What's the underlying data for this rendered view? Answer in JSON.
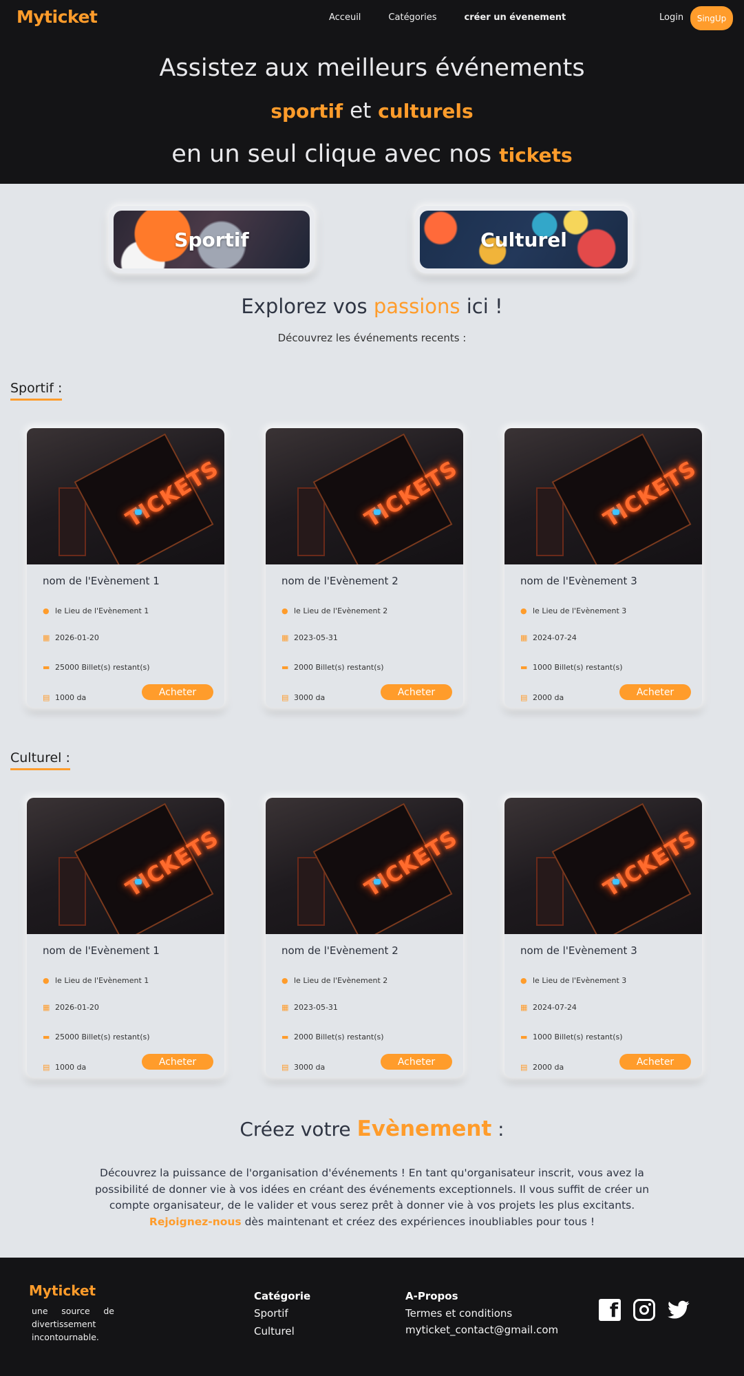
{
  "colors": {
    "accent": "#ff9c2b",
    "dark": "#141416",
    "background": "#e2e5e9"
  },
  "header": {
    "logo": "Myticket",
    "nav": [
      "Acceuil",
      "Catégories",
      "créer un évenement"
    ],
    "login": "Login",
    "signup": "SingUp"
  },
  "hero": {
    "line1": "Assistez aux meilleurs événements",
    "line2_a": "sportif",
    "line2_b": " et ",
    "line2_c": "culturels",
    "line3_a": "en un seul clique avec nos ",
    "line3_b": "tickets"
  },
  "categories": [
    {
      "label": "Sportif"
    },
    {
      "label": "Culturel"
    }
  ],
  "explore": {
    "a": "Explorez vos ",
    "b": "passions",
    "c": " ici !",
    "subtitle": "Découvrez les événements recents :"
  },
  "sections": [
    {
      "title": "Sportif :",
      "cards": [
        {
          "name": "nom de l'Evènement 1",
          "place": "le Lieu de l'Evènement 1",
          "date": "2026-01-20",
          "tickets": "25000 Billet(s) restant(s)",
          "price": "1000 da",
          "button": "Acheter"
        },
        {
          "name": "nom de l'Evènement 2",
          "place": "le Lieu de l'Evènement 2",
          "date": "2023-05-31",
          "tickets": "2000 Billet(s) restant(s)",
          "price": "3000 da",
          "button": "Acheter"
        },
        {
          "name": "nom de l'Evènement 3",
          "place": "le Lieu de l'Evènement 3",
          "date": "2024-07-24",
          "tickets": "1000 Billet(s) restant(s)",
          "price": "2000 da",
          "button": "Acheter"
        }
      ]
    },
    {
      "title": "Culturel :",
      "cards": [
        {
          "name": "nom de l'Evènement 1",
          "place": "le Lieu de l'Evènement 1",
          "date": "2026-01-20",
          "tickets": "25000 Billet(s) restant(s)",
          "price": "1000 da",
          "button": "Acheter"
        },
        {
          "name": "nom de l'Evènement 2",
          "place": "le Lieu de l'Evènement 2",
          "date": "2023-05-31",
          "tickets": "2000 Billet(s) restant(s)",
          "price": "3000 da",
          "button": "Acheter"
        },
        {
          "name": "nom de l'Evènement 3",
          "place": "le Lieu de l'Evènement 3",
          "date": "2024-07-24",
          "tickets": "1000 Billet(s) restant(s)",
          "price": "2000 da",
          "button": "Acheter"
        }
      ]
    }
  ],
  "card_image_text": "TICKETS",
  "create": {
    "title_a": "Créez votre ",
    "title_b": "Evènement",
    "title_c": " :",
    "text_1": "Découvrez la puissance de l'organisation d'événements ! En tant qu'organisateur inscrit, vous avez la possibilité de donner vie à vos idées en créant des événements exceptionnels. Il vous suffit de créer un compte organisateur, de le valider et vous serez prêt à donner vie à vos projets les plus excitants.",
    "link": "Rejoignez-nous",
    "text_2": " dès maintenant et créez des expériences inoubliables pour tous !"
  },
  "footer": {
    "logo": "Myticket",
    "tagline": "une source de divertissement incontournable.",
    "categories_title": "Catégorie",
    "categories": [
      "Sportif",
      "Culturel"
    ],
    "about_title": "A-Propos",
    "about": [
      "Termes et conditions",
      "myticket_contact@gmail.com"
    ],
    "social": [
      "facebook-icon",
      "instagram-icon",
      "twitter-icon"
    ]
  }
}
